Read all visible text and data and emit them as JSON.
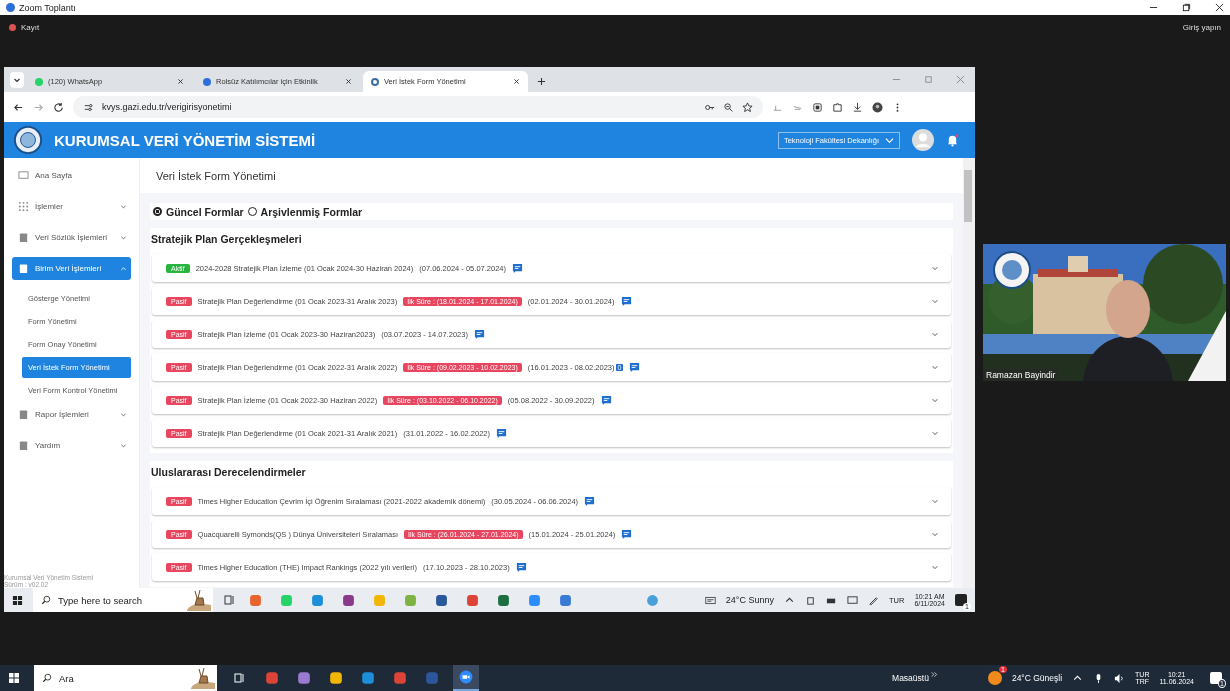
{
  "zoom": {
    "title": "Zoom Toplantı",
    "recording": "Kayıt",
    "sign_in": "Giriş yapın"
  },
  "browser": {
    "tabs": [
      {
        "title": "(120) WhatsApp",
        "selected": false
      },
      {
        "title": "Rolsüz Katılımcılar için Etkinlik",
        "selected": false
      },
      {
        "title": "Veri İstek Form Yönetimi",
        "selected": true
      }
    ],
    "url": "kvys.gazi.edu.tr/verigirisyonetimi"
  },
  "app": {
    "title": "KURUMSAL VERİ YÖNETİM SİSTEMİ",
    "unit": "Teknoloji Fakültesi Dekanlığı"
  },
  "sidebar": {
    "items": [
      {
        "label": "Ana Sayfa",
        "selected": false
      },
      {
        "label": "İşlemler",
        "selected": false,
        "expanded": false
      },
      {
        "label": "Veri Sözlük İşlemleri",
        "selected": false,
        "expanded": false
      },
      {
        "label": "Birim Veri İşlemleri",
        "selected": true,
        "expanded": true,
        "children": [
          {
            "label": "Gösterge Yönetimi",
            "selected": false
          },
          {
            "label": "Form Yönetimi",
            "selected": false
          },
          {
            "label": "Form Onay Yönetimi",
            "selected": false
          },
          {
            "label": "Veri İstek Form Yönetimi",
            "selected": true
          },
          {
            "label": "Veri Form Kontrol Yönetimi",
            "selected": false
          }
        ]
      },
      {
        "label": "Rapor İşlemleri",
        "selected": false,
        "expanded": false
      },
      {
        "label": "Yardım",
        "selected": false,
        "expanded": false
      }
    ],
    "footer": [
      "Kurumsal Veri Yönetim Sistemi",
      "Sürüm : v02.02"
    ]
  },
  "page": {
    "title": "Veri İstek Form Yönetimi",
    "filters": [
      {
        "label": "Güncel Formlar",
        "selected": true
      },
      {
        "label": "Arşivlenmiş Formlar",
        "selected": false
      }
    ],
    "sections": [
      {
        "title": "Stratejik Plan Gerçekleşmeleri",
        "forms": [
          {
            "status": "Aktif",
            "active": true,
            "name": "2024-2028 Stratejik Plan İzleme (01 Ocak 2024-30 Haziran 2024)",
            "dates": "(07.06.2024 - 05.07.2024)"
          },
          {
            "status": "Pasif",
            "active": false,
            "name": "Stratejik Plan Değerlendirme (01 Ocak 2023-31 Aralık 2023)",
            "extension": "İlk Süre : (18.01.2024 - 17.01.2024)",
            "dates": "(02.01.2024 - 30.01.2024)"
          },
          {
            "status": "Pasif",
            "active": false,
            "name": "Stratejik Plan İzleme (01 Ocak 2023-30 Haziran2023)",
            "dates": "(03.07.2023 - 14.07.2023)"
          },
          {
            "status": "Pasif",
            "active": false,
            "name": "Stratejik Plan Değerlendirme (01 Ocak 2022-31 Aralık 2022)",
            "extension": "İlk Süre : (09.02.2023 - 10.02.2023)",
            "dates": "(16.01.2023 - 08.02.2023)",
            "count": "0"
          },
          {
            "status": "Pasif",
            "active": false,
            "name": "Stratejik Plan İzleme (01 Ocak 2022-30 Haziran 2022)",
            "extension": "İlk Süre : (03.10.2022 - 06.10.2022)",
            "dates": "(05.08.2022 - 30.09.2022)"
          },
          {
            "status": "Pasif",
            "active": false,
            "name": "Stratejik Plan Değerlendirme (01 Ocak 2021-31 Aralık 2021)",
            "dates": "(31.01.2022 - 16.02.2022)"
          }
        ]
      },
      {
        "title": "Uluslararası Derecelendirmeler",
        "forms": [
          {
            "status": "Pasif",
            "active": false,
            "name": "Times Higher Education Çevrim İçi Öğrenim Sıralaması (2021-2022 akademik dönemi)",
            "dates": "(30.05.2024 - 06.06.2024)"
          },
          {
            "status": "Pasif",
            "active": false,
            "name": "Quacquarelli Symonds(QS ) Dünya Üniversiteleri Sıralaması",
            "extension": "İlk Süre : (26.01.2024 - 27.01.2024)",
            "dates": "(15.01.2024 - 25.01.2024)"
          },
          {
            "status": "Pasif",
            "active": false,
            "name": "Times Higher Education (THE) Impact Rankings (2022 yılı verileri)",
            "dates": "(17.10.2023 - 28.10.2023)"
          }
        ]
      }
    ]
  },
  "inner_taskbar": {
    "search": {
      "placeholder": "Type here to search"
    },
    "weather": "24°C Sunny",
    "language": "TUR",
    "time": "10:21 AM",
    "date": "6/11/2024",
    "notifications": "1"
  },
  "video": {
    "name": "Ramazan Bayindir"
  },
  "taskbar": {
    "search": {
      "placeholder": "Ara"
    },
    "desktop": "Masaüstü",
    "weather": "24°C Güneşli",
    "weather_badge": "1",
    "language": [
      "TUR",
      "TRF"
    ],
    "time": "10:21",
    "date": "11.06.2024",
    "notifications": "1"
  }
}
